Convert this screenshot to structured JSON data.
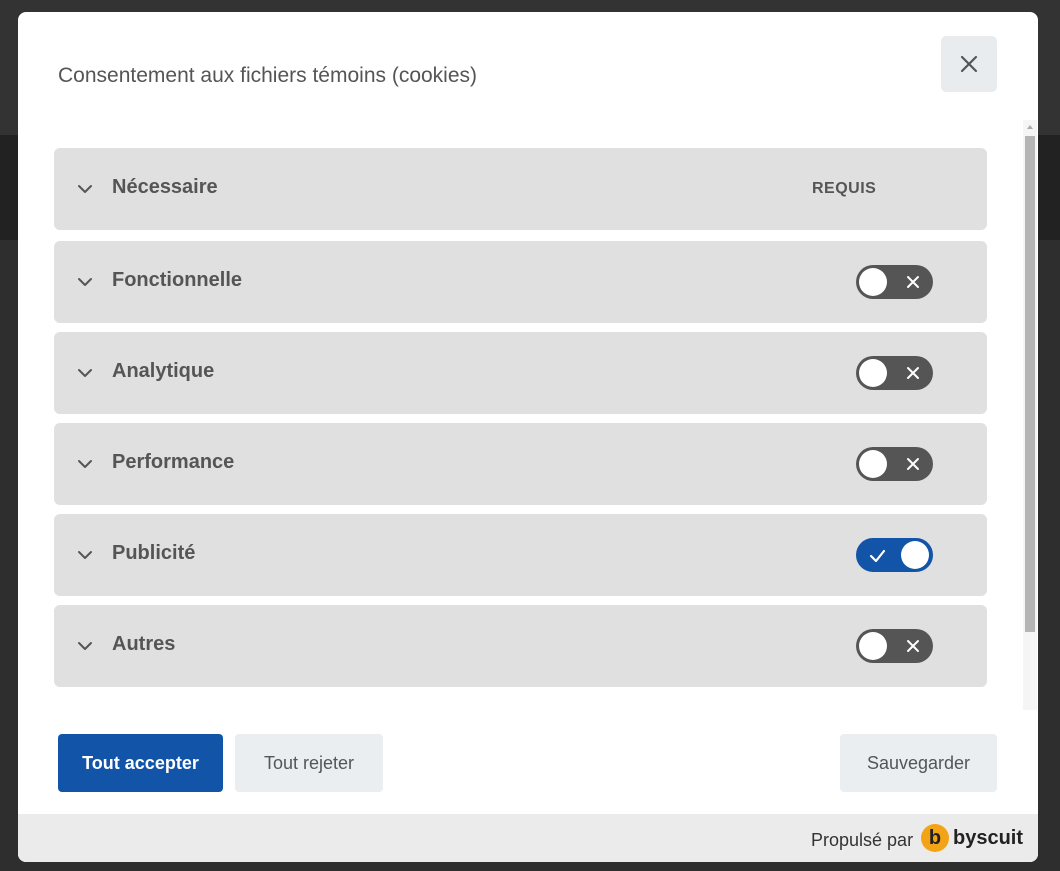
{
  "modal": {
    "title": "Consentement aux fichiers témoins (cookies)"
  },
  "categories": [
    {
      "label": "Nécessaire",
      "required_label": "REQUIS"
    },
    {
      "label": "Fonctionnelle",
      "enabled": false
    },
    {
      "label": "Analytique",
      "enabled": false
    },
    {
      "label": "Performance",
      "enabled": false
    },
    {
      "label": "Publicité",
      "enabled": true
    },
    {
      "label": "Autres",
      "enabled": false
    }
  ],
  "actions": {
    "accept_all": "Tout accepter",
    "reject_all": "Tout rejeter",
    "save": "Sauvegarder"
  },
  "footer": {
    "powered_by": "Propulsé par",
    "brand": "byscuit",
    "brand_initial": "b"
  },
  "icons": {
    "close": "close-icon",
    "expand": "chevron-down-icon",
    "toggle_off": "x-icon",
    "toggle_on": "check-icon"
  },
  "colors": {
    "accent": "#1254a8",
    "toggle_off": "#555555",
    "row_bg": "#e0e0e0",
    "brand": "#f3a316"
  }
}
